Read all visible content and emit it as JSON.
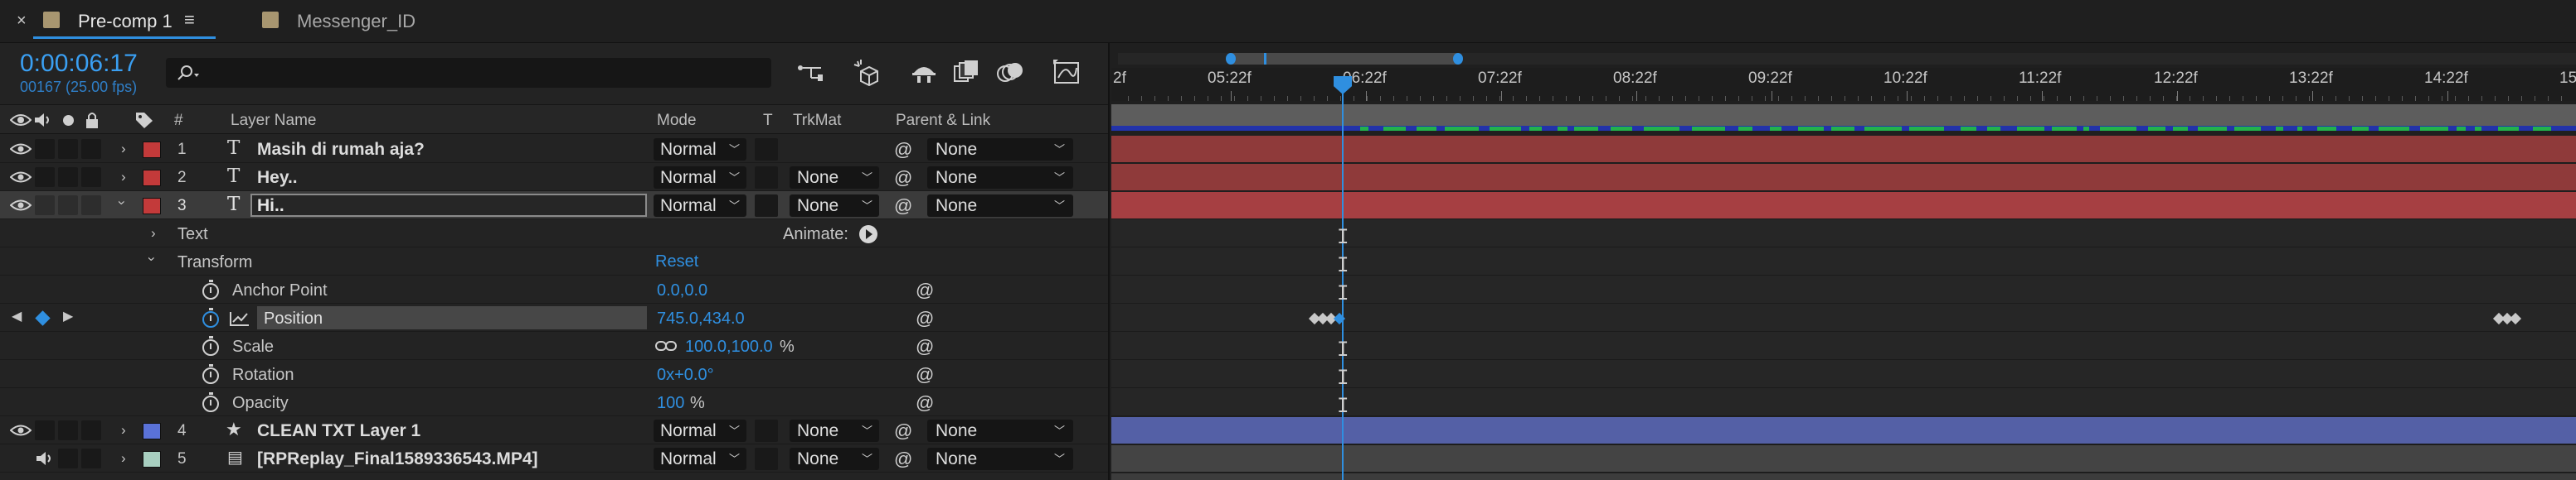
{
  "tabs": [
    {
      "label": "Pre-comp 1",
      "close": "×",
      "menu": "≡",
      "active": true
    },
    {
      "label": "Messenger_ID",
      "active": false
    }
  ],
  "timecode": "0:00:06:17",
  "frame_info": "00167 (25.00 fps)",
  "search": {
    "placeholder": "",
    "icon": "search-icon"
  },
  "columns": {
    "label_col": "#",
    "layer_name": "Layer Name",
    "mode": "Mode",
    "t": "T",
    "trkmat": "TrkMat",
    "parent": "Parent & Link"
  },
  "layers": [
    {
      "num": "1",
      "type_icon": "T",
      "name": "Masih di rumah aja?",
      "mode": "Normal",
      "trkmat": "",
      "parent": "None",
      "color": "#c33a3a"
    },
    {
      "num": "2",
      "type_icon": "T",
      "name": "Hey..",
      "mode": "Normal",
      "trkmat": "None",
      "parent": "None",
      "color": "#c33a3a"
    },
    {
      "num": "3",
      "type_icon": "T",
      "name": "Hi..",
      "mode": "Normal",
      "trkmat": "None",
      "parent": "None",
      "color": "#c33a3a",
      "selected": true
    },
    {
      "num": "4",
      "type_icon": "★",
      "name": "CLEAN TXT Layer 1",
      "mode": "Normal",
      "trkmat": "None",
      "parent": "None",
      "color": "#5a72d8"
    },
    {
      "num": "5",
      "type_icon": "▤",
      "name": "[RPReplay_Final1589336543.MP4]",
      "mode": "Normal",
      "trkmat": "None",
      "parent": "None",
      "color": "#a8cfc0"
    }
  ],
  "groups": {
    "text": "Text",
    "animate": "Animate:",
    "transform": "Transform",
    "reset": "Reset"
  },
  "properties": [
    {
      "name": "Anchor Point",
      "value": "0.0,0.0",
      "suffix": ""
    },
    {
      "name": "Position",
      "value": "745.0,434.0",
      "suffix": ""
    },
    {
      "name": "Scale",
      "value": "100.0,100.0",
      "suffix": "%"
    },
    {
      "name": "Rotation",
      "value": "0x+0.0°",
      "suffix": ""
    },
    {
      "name": "Opacity",
      "value": "100",
      "suffix": "%"
    }
  ],
  "ruler_labels": [
    "2f",
    "05:22f",
    "06:22f",
    "07:22f",
    "08:22f",
    "09:22f",
    "10:22f",
    "11:22f",
    "12:22f",
    "13:22f",
    "14:22f",
    "15"
  ],
  "colors": {
    "accent": "#2f8fe0",
    "text_layer_bar": "#9a3b3b",
    "shape_layer_bar": "#5460a6",
    "video_layer_bar": "#4a4a4a"
  }
}
